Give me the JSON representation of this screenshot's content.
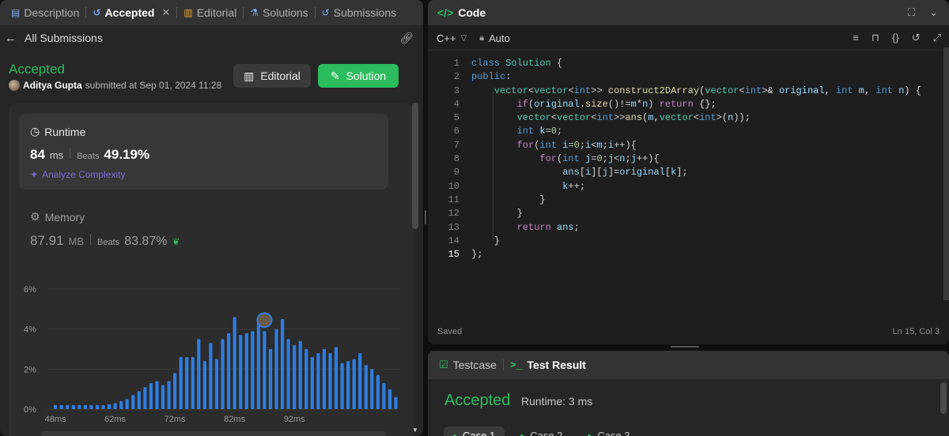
{
  "left_tabs": [
    {
      "label": "Description",
      "icon": "description-icon"
    },
    {
      "label": "Accepted",
      "icon": "history-icon"
    },
    {
      "label": "Editorial",
      "icon": "book-icon"
    },
    {
      "label": "Solutions",
      "icon": "flask-icon"
    },
    {
      "label": "Submissions",
      "icon": "history-icon"
    }
  ],
  "sub_header": {
    "back_label": "All Submissions"
  },
  "submission": {
    "status": "Accepted",
    "author": "Aditya Gupta",
    "submitted_text": "submitted at Sep 01, 2024 11:28",
    "editorial_button": "Editorial",
    "solution_button": "Solution"
  },
  "runtime": {
    "label": "Runtime",
    "value": "84",
    "unit": "ms",
    "beats_label": "Beats",
    "beats_value": "49.19%",
    "analyze_label": "Analyze Complexity"
  },
  "memory": {
    "label": "Memory",
    "value": "87.91",
    "unit": "MB",
    "beats_label": "Beats",
    "beats_value": "83.87%"
  },
  "chart_data": {
    "type": "bar",
    "ylabel_ticks": [
      "0%",
      "2%",
      "4%",
      "6%"
    ],
    "xlabel_ticks": [
      "48ms",
      "62ms",
      "72ms",
      "82ms",
      "92ms"
    ],
    "ylim": [
      0,
      6
    ],
    "values": [
      0.2,
      0.2,
      0.2,
      0.2,
      0.2,
      0.2,
      0.2,
      0.2,
      0.2,
      0.25,
      0.3,
      0.4,
      0.5,
      0.7,
      0.9,
      1.1,
      1.3,
      1.4,
      1.2,
      1.4,
      1.8,
      2.6,
      2.6,
      2.6,
      3.5,
      2.4,
      3.3,
      2.5,
      3.5,
      3.8,
      4.6,
      3.7,
      3.8,
      3.9,
      4.3,
      3.9,
      3.0,
      4.0,
      4.5,
      3.5,
      3.2,
      3.4,
      3.0,
      2.6,
      2.8,
      3.0,
      2.8,
      3.1,
      2.3,
      2.4,
      2.5,
      2.8,
      2.2,
      2.0,
      1.7,
      1.3,
      1.0,
      0.6
    ],
    "highlight_index": 35,
    "bar_color": "#2f7de1",
    "highlight_color": "#2f7de1"
  },
  "code_panel": {
    "title": "Code",
    "language": "C++",
    "mode": "Auto",
    "saved_text": "Saved",
    "cursor_text": "Ln 15, Col 3",
    "line_numbers": [
      "1",
      "2",
      "3",
      "4",
      "5",
      "6",
      "7",
      "8",
      "9",
      "10",
      "11",
      "12",
      "13",
      "14",
      "15"
    ]
  },
  "test_result": {
    "tab_testcase": "Testcase",
    "tab_result": "Test Result",
    "status": "Accepted",
    "runtime_text": "Runtime: 3 ms",
    "cases": [
      "Case 1",
      "Case 2",
      "Case 3"
    ]
  },
  "colors": {
    "accent_green": "#2cbb5d",
    "bar_blue": "#2f7de1",
    "panel_bg": "#262626"
  }
}
